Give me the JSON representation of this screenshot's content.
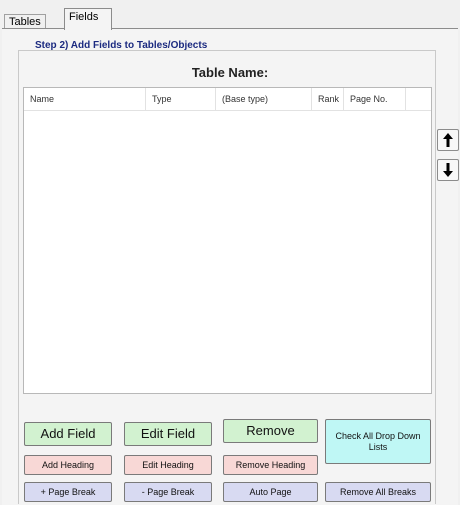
{
  "tabs": [
    {
      "label": "Tables",
      "active": false
    },
    {
      "label": "Fields",
      "active": true
    }
  ],
  "step_title": "Step 2) Add Fields to Tables/Objects",
  "table_name_label": "Table Name:",
  "columns": [
    "Name",
    "Type",
    "(Base type)",
    "Rank",
    "Page No."
  ],
  "rows": [],
  "icons": {
    "move_up": "arrow-up-icon",
    "move_down": "arrow-down-icon"
  },
  "buttons": {
    "add_field": "Add Field",
    "edit_field": "Edit Field",
    "remove": "Remove",
    "check_all": "Check All Drop Down Lists",
    "add_heading": "Add Heading",
    "edit_heading": "Edit Heading",
    "remove_heading": "Remove Heading",
    "add_page_break": "+ Page Break",
    "remove_page_break": "- Page Break",
    "auto_page": "Auto Page",
    "remove_all_breaks": "Remove All Breaks"
  },
  "colors": {
    "green": "#d2f2d0",
    "pink": "#f8d8d6",
    "lavender": "#d8daf2",
    "cyan": "#bff7f5",
    "title_blue": "#1b2a80"
  }
}
